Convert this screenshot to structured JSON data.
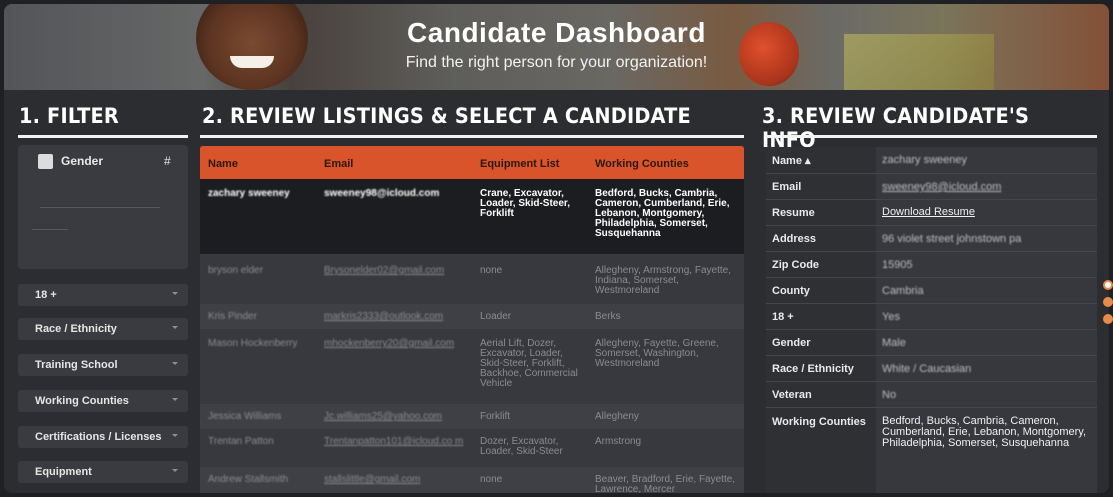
{
  "header": {
    "title": "Candidate Dashboard",
    "subtitle": "Find the right person for your organization!"
  },
  "sections": {
    "filter": "1. FILTER",
    "listings": "2. REVIEW LISTINGS & SELECT A CANDIDATE",
    "info": "3. REVIEW CANDIDATE'S INFO"
  },
  "filter": {
    "gender_label": "Gender",
    "gender_count_header": "#",
    "dropdowns": [
      "18 +",
      "Race / Ethnicity",
      "Training School",
      "Working Counties",
      "Certifications / Licenses",
      "Equipment"
    ]
  },
  "listings": {
    "columns": [
      "Name",
      "Email",
      "Equipment List",
      "Working Counties"
    ],
    "rows": [
      {
        "name": "zachary sweeney",
        "email": "sweeney98@icloud.com",
        "equipment": "Crane, Excavator, Loader, Skid-Steer, Forklift",
        "counties": "Bedford, Bucks, Cambria, Cameron, Cumberland, Erie, Lebanon, Montgomery, Philadelphia, Somerset, Susquehanna"
      },
      {
        "name": "bryson elder",
        "email": "Brysonelder02@gmail.com",
        "equipment": "none",
        "counties": "Allegheny, Armstrong, Fayette, Indiana, Somerset, Westmoreland"
      },
      {
        "name": "Kris Pinder",
        "email": "markris2333@outlook.com",
        "equipment": "Loader",
        "counties": "Berks"
      },
      {
        "name": "Mason Hockenberry",
        "email": "mhockenberry20@gmail.com",
        "equipment": "Aerial Lift, Dozer, Excavator, Loader, Skid-Steer, Forklift, Backhoe, Commercial Vehicle",
        "counties": "Allegheny, Fayette, Greene, Somerset, Washington, Westmoreland"
      },
      {
        "name": "Jessica Williams",
        "email": "Jc.williams25@yahoo.com",
        "equipment": "Forklift",
        "counties": "Allegheny"
      },
      {
        "name": "Trentan Patton",
        "email": "Trentanpatton101@icloud.co m",
        "equipment": "Dozer, Excavator, Loader, Skid-Steer",
        "counties": "Armstrong"
      },
      {
        "name": "Andrew Stallsmith",
        "email": "stallslittle@gmail.com",
        "equipment": "none",
        "counties": "Beaver, Bradford, Erie, Fayette, Lawrence, Mercer"
      }
    ]
  },
  "info": {
    "rows": [
      {
        "key": "Name ▴",
        "value": "zachary sweeney"
      },
      {
        "key": "Email",
        "value": "sweeney98@icloud.com"
      },
      {
        "key": "Resume",
        "value": "Download Resume"
      },
      {
        "key": "Address",
        "value": "96 violet street johnstown pa"
      },
      {
        "key": "Zip Code",
        "value": "15905"
      },
      {
        "key": "County",
        "value": "Cambria"
      },
      {
        "key": "18 +",
        "value": "Yes"
      },
      {
        "key": "Gender",
        "value": "Male"
      },
      {
        "key": "Race / Ethnicity",
        "value": "White / Caucasian"
      },
      {
        "key": "Veteran",
        "value": "No"
      },
      {
        "key": "Working Counties",
        "value": "Bedford, Bucks, Cambria, Cameron, Cumberland, Erie, Lebanon, Montgomery, Philadelphia, Somerset, Susquehanna"
      }
    ]
  },
  "colors": {
    "accent": "#d9532b",
    "background": "#2c2d31"
  }
}
